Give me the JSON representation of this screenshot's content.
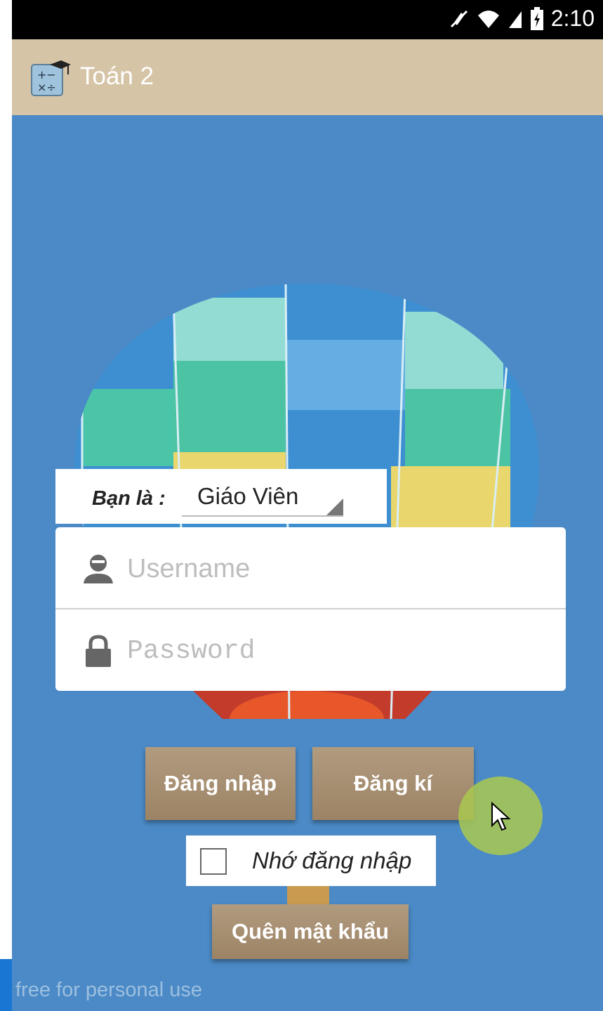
{
  "status_bar": {
    "time": "2:10",
    "icons": [
      "muted-icon",
      "wifi-icon",
      "signal-icon",
      "battery-charging-icon"
    ]
  },
  "app": {
    "title": "Toán 2",
    "icon": "calculator-graduation-icon"
  },
  "role": {
    "label": "Bạn là :",
    "selected": "Giáo Viên"
  },
  "form": {
    "username": {
      "placeholder": "Username",
      "value": ""
    },
    "password": {
      "placeholder": "Password",
      "value": ""
    }
  },
  "buttons": {
    "login": "Đăng nhập",
    "register": "Đăng kí",
    "forgot_password": "Quên mật khẩu"
  },
  "remember": {
    "label": "Nhớ đăng nhập",
    "checked": false
  },
  "watermark": "free for personal use",
  "colors": {
    "action_bar": "#d6c4a6",
    "background": "#4b8ac6",
    "button": "#a88f72"
  }
}
